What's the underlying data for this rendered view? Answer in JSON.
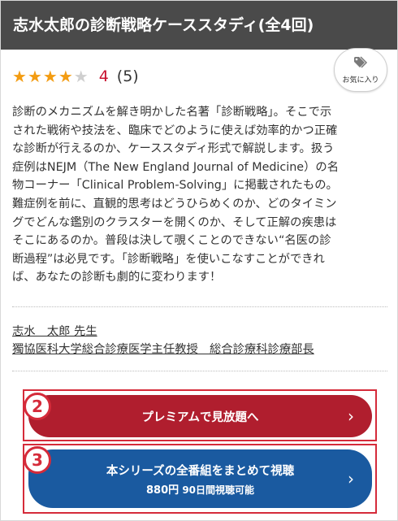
{
  "header": {
    "title": "志水太郎の診断戦略ケーススタディ(全4回)"
  },
  "rating": {
    "stars_filled": 4,
    "stars_total": 5,
    "value": "4",
    "count": "(5)"
  },
  "favorite": {
    "label": "お気に入り",
    "icon": "tag-icon"
  },
  "description": "診断のメカニズムを解き明かした名著「診断戦略」。そこで示\nされた戦術や技法を、臨床でどのように使えば効率的かつ正確\nな診断が行えるのか、ケーススタディ形式で解説します。扱う\n症例はNEJM（The New England Journal of Medicine）の名\n物コーナー「Clinical Problem-Solving」に掲載されたもの。\n難症例を前に、直観的思考はどうひらめくのか、どのタイミン\nグでどんな鑑別のクラスターを開くのか、そして正解の疾患は\nそこにあるのか。普段は決して覗くことのできない“名医の診\n断過程”は必見です。「診断戦略」を使いこなすことができれ\nば、あなたの診断も劇的に変わります！",
  "author": {
    "name": "志水　太郎 先生",
    "affiliation": "獨協医科大学総合診療医学主任教授　総合診療科診療部長"
  },
  "cta_premium": {
    "number": "2",
    "label": "プレミアムで見放題へ",
    "chevron": "›"
  },
  "cta_series": {
    "number": "3",
    "label": "本シリーズの全番組をまとめて視聴",
    "price": "880円",
    "note": "90日間視聴可能",
    "chevron": "›"
  },
  "colors": {
    "header_bg": "#4a4a4a",
    "star": "#f39c12",
    "rating_value": "#c8102e",
    "premium_button": "#b01e2e",
    "series_button": "#1a5aa0",
    "annotation": "#d52b3a"
  }
}
